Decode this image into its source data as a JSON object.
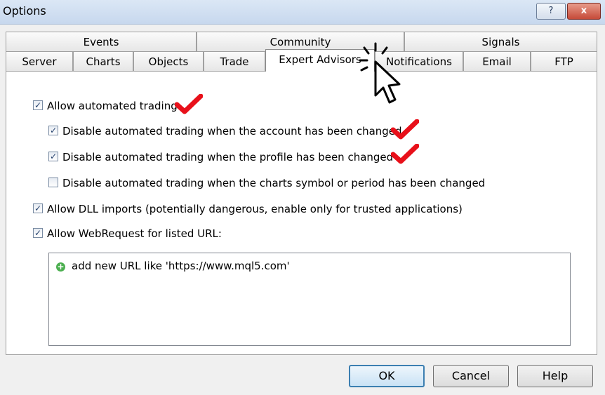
{
  "window": {
    "title": "Options",
    "help_glyph": "?",
    "close_glyph": "x"
  },
  "tabs": {
    "row1": [
      "Events",
      "Community",
      "Signals"
    ],
    "row2": [
      "Server",
      "Charts",
      "Objects",
      "Trade",
      "Expert Advisors",
      "Notifications",
      "Email",
      "FTP"
    ],
    "active": "Expert Advisors"
  },
  "options": {
    "allow_automated": {
      "label": "Allow automated trading",
      "checked": true
    },
    "disable_account": {
      "label": "Disable automated trading when the account has been changed",
      "checked": true
    },
    "disable_profile": {
      "label": "Disable automated trading when the profile has been changed",
      "checked": true
    },
    "disable_symbol": {
      "label": "Disable automated trading when the charts symbol or period has been changed",
      "checked": false
    },
    "allow_dll": {
      "label": "Allow DLL imports (potentially dangerous, enable only for trusted applications)",
      "checked": true
    },
    "allow_webrequest": {
      "label": "Allow WebRequest for listed URL:",
      "checked": true
    }
  },
  "url_list": {
    "placeholder": "add new URL like 'https://www.mql5.com'",
    "icon": "plus-circle-icon"
  },
  "buttons": {
    "ok": "OK",
    "cancel": "Cancel",
    "help": "Help"
  },
  "annotation_color": "#e8101a"
}
